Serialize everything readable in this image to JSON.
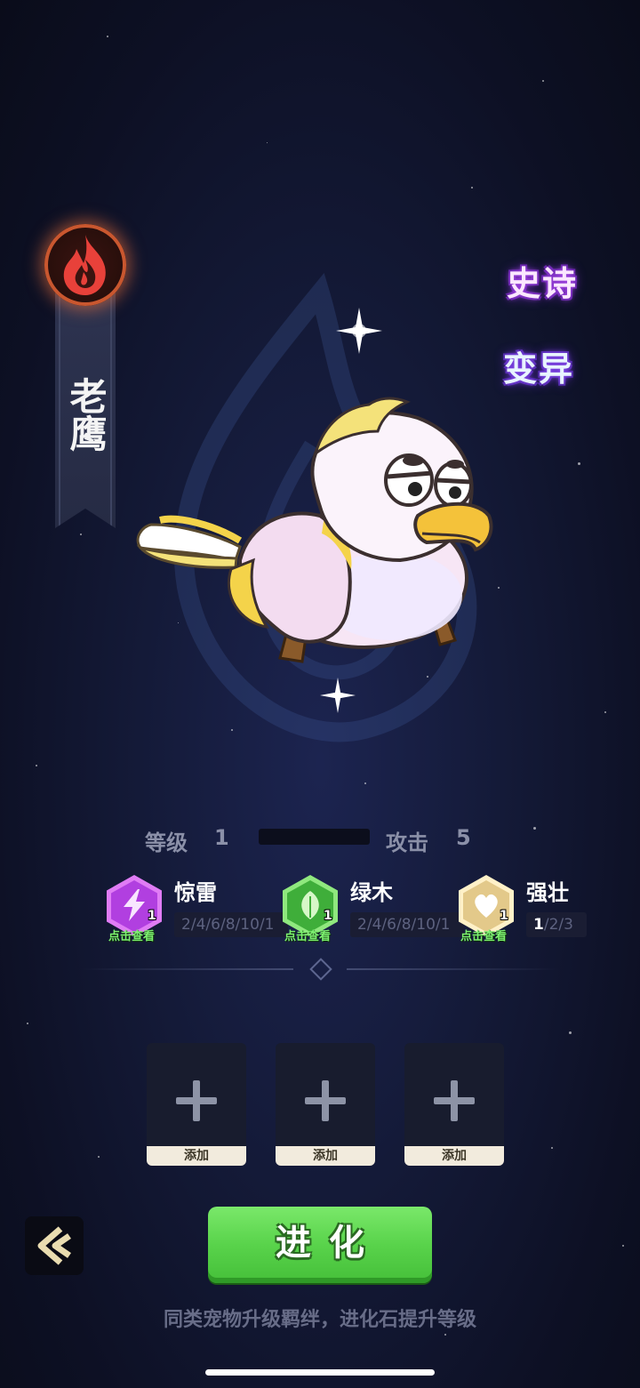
{
  "pet": {
    "element": "fire",
    "element_icon": "fire-emblem-icon",
    "name": "老鹰",
    "rarity": "史诗",
    "mutation": "变异"
  },
  "stats": {
    "level_label": "等级",
    "level_value": "1",
    "level_progress": 0,
    "attack_label": "攻击",
    "attack_value": "5"
  },
  "traits": [
    {
      "name": "惊雷",
      "count": "1",
      "hint": "点击查看",
      "tiers": [
        "2",
        "4",
        "6",
        "8",
        "10",
        "1"
      ],
      "active_tier": -1,
      "icon": "lightning-icon",
      "color": "#b13fe0"
    },
    {
      "name": "绿木",
      "count": "1",
      "hint": "点击查看",
      "tiers": [
        "2",
        "4",
        "6",
        "8",
        "10",
        "1"
      ],
      "active_tier": -1,
      "icon": "leaf-icon",
      "color": "#3fae3a"
    },
    {
      "name": "强壮",
      "count": "1",
      "hint": "点击查看",
      "tiers": [
        "1",
        "2",
        "3"
      ],
      "active_tier": 0,
      "icon": "heart-icon",
      "color": "#e3c98a"
    }
  ],
  "slots": [
    {
      "label": "添加"
    },
    {
      "label": "添加"
    },
    {
      "label": "添加"
    }
  ],
  "actions": {
    "back_icon": "back-arrow-icon",
    "evolve_label": "进化"
  },
  "hint": "同类宠物升级羁绊，进化石提升等级"
}
